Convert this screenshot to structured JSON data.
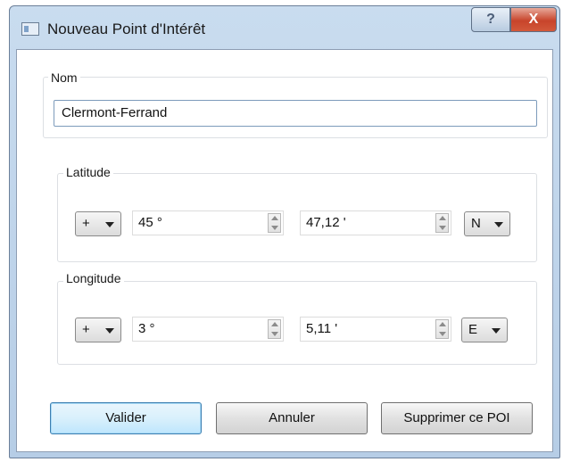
{
  "window": {
    "title": "Nouveau Point d'Intérêt",
    "help": "?",
    "close": "X"
  },
  "name": {
    "label": "Nom",
    "value": "Clermont-Ferrand"
  },
  "latitude": {
    "label": "Latitude",
    "sign": "+",
    "degrees": "45 °",
    "minutes": "47,12 '",
    "hemisphere": "N"
  },
  "longitude": {
    "label": "Longitude",
    "sign": "+",
    "degrees": "3 °",
    "minutes": "5,11 '",
    "hemisphere": "E"
  },
  "buttons": {
    "validate": "Valider",
    "cancel": "Annuler",
    "delete": "Supprimer ce POI"
  }
}
